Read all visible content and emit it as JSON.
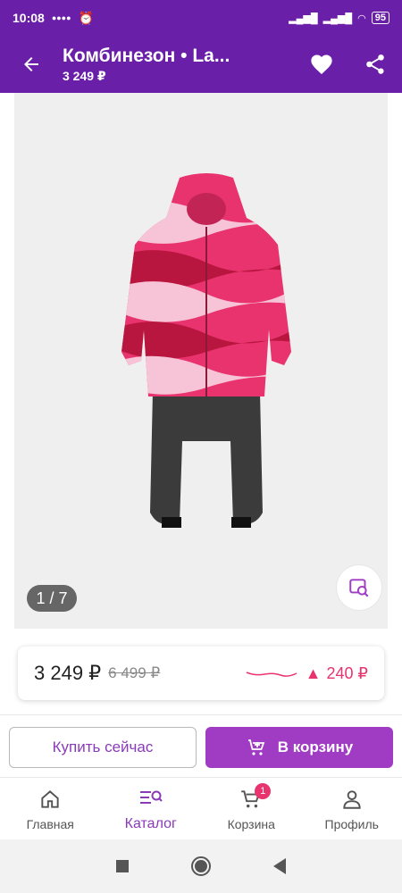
{
  "status_bar": {
    "time": "10:08",
    "battery": "95"
  },
  "header": {
    "title": "Комбинезон • La...",
    "price": "3 249 ₽"
  },
  "gallery": {
    "pager": "1 / 7"
  },
  "price_card": {
    "current": "3 249 ₽",
    "old": "6 499 ₽",
    "delta": "240 ₽"
  },
  "actions": {
    "buy_now": "Купить сейчас",
    "add_to_cart": "В корзину"
  },
  "bottom_nav": {
    "items": [
      {
        "label": "Главная",
        "icon": "home-icon"
      },
      {
        "label": "Каталог",
        "icon": "catalog-icon"
      },
      {
        "label": "Корзина",
        "icon": "cart-icon",
        "badge": "1"
      },
      {
        "label": "Профиль",
        "icon": "profile-icon"
      }
    ]
  },
  "colors": {
    "brand": "#6a1fa8",
    "accent": "#a03bc4",
    "pink": "#e8336e"
  }
}
